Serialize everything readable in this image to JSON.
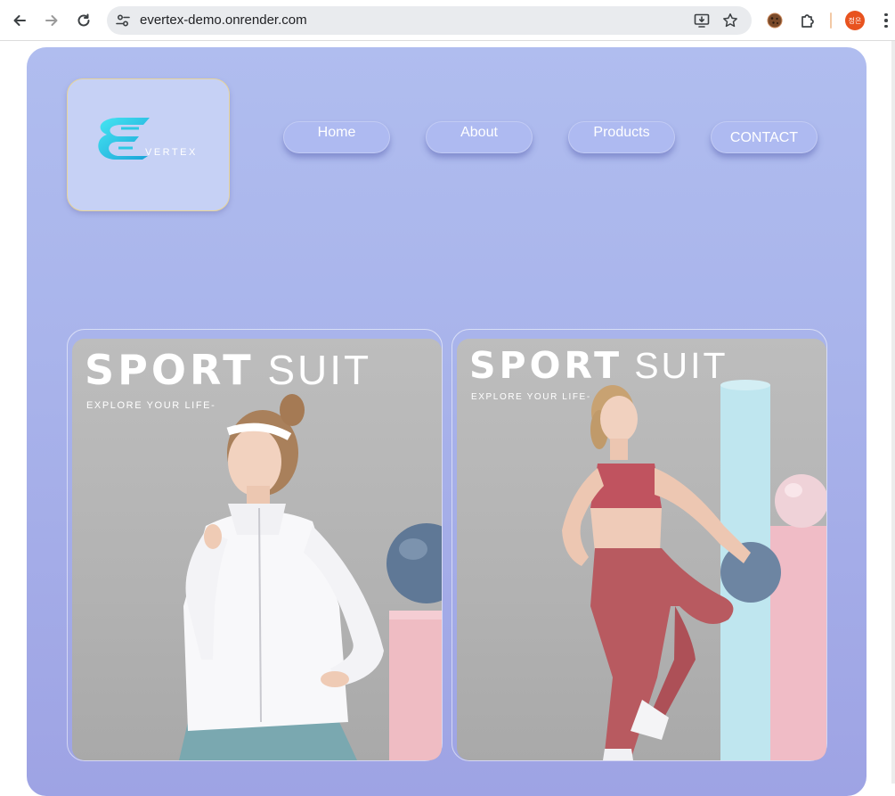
{
  "browser": {
    "url": "evertex-demo.onrender.com",
    "profile_initials": "정은",
    "icons": [
      "back-arrow-icon",
      "forward-arrow-icon",
      "reload-icon",
      "site-settings-icon",
      "install-app-icon",
      "bookmark-star-icon",
      "cookie-extension-icon",
      "puzzle-extensions-icon",
      "kebab-menu-icon"
    ]
  },
  "site": {
    "logo_text": "VERTEX",
    "nav": [
      {
        "label": "Home"
      },
      {
        "label": "About"
      },
      {
        "label": "Products"
      },
      {
        "label": "CONTACT"
      }
    ],
    "banners": [
      {
        "title_bold": "SPORT",
        "title_light": "SUIT",
        "subtitle": "EXPLORE YOUR LIFE-"
      },
      {
        "title_bold": "SPORT",
        "title_light": "SUIT",
        "subtitle": "EXPLORE YOUR LIFE-"
      }
    ]
  },
  "colors": {
    "page_card_top": "#b0bdef",
    "page_card_bottom": "#9ea3e4",
    "nav_pill": "#aebaf1",
    "logo_box": "#c6d1f5",
    "logo_accent": "#2fd0e6",
    "profile_badge": "#e8531f"
  }
}
